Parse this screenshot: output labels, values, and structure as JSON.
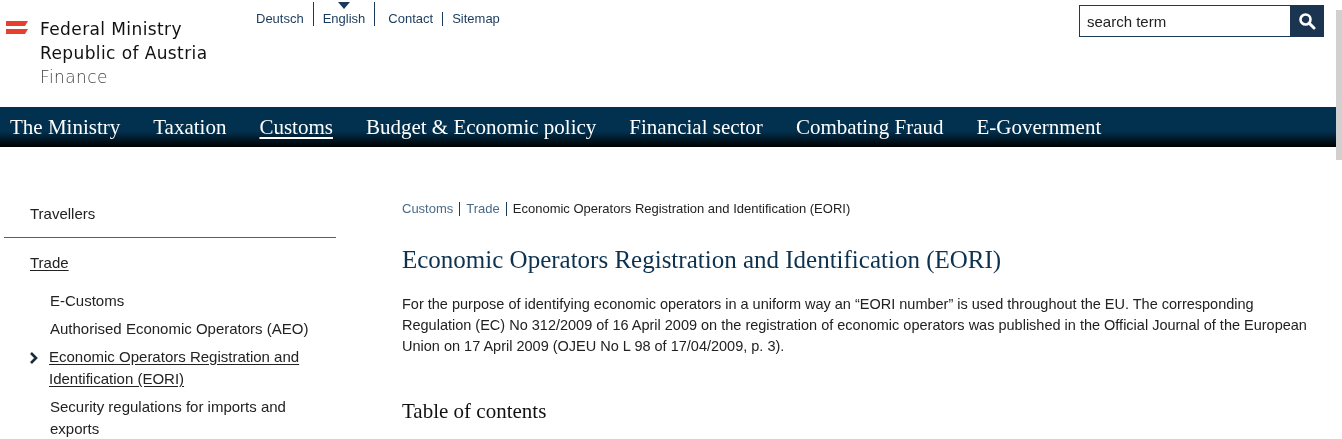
{
  "logo": {
    "lines": [
      "Federal Ministry",
      "Republic of Austria",
      "Finance"
    ]
  },
  "languages": [
    {
      "label": "Deutsch",
      "selected": false
    },
    {
      "label": "English",
      "selected": true
    }
  ],
  "service_links": [
    "Contact",
    "Sitemap"
  ],
  "search": {
    "placeholder": "search term"
  },
  "nav": [
    {
      "label": "The Ministry",
      "selected": false
    },
    {
      "label": "Taxation",
      "selected": false
    },
    {
      "label": "Customs",
      "selected": true
    },
    {
      "label": "Budget & Economic policy",
      "selected": false
    },
    {
      "label": "Financial sector",
      "selected": false
    },
    {
      "label": "Combating Fraud",
      "selected": false
    },
    {
      "label": "E-Government",
      "selected": false
    }
  ],
  "sidebar": {
    "items": [
      {
        "label": "Travellers",
        "expanded": false
      },
      {
        "label": "Trade",
        "expanded": true,
        "children": [
          {
            "label": "E-Customs",
            "selected": false
          },
          {
            "label": "Authorised Economic Operators (AEO)",
            "selected": false
          },
          {
            "label": "Economic Operators Registration and Identification (EORI)",
            "selected": true
          },
          {
            "label": "Security regulations for imports and exports",
            "selected": false
          }
        ]
      }
    ]
  },
  "breadcrumb": [
    "Customs",
    "Trade",
    "Economic Operators Registration and Identification (EORI)"
  ],
  "title": "Economic Operators Registration and Identification (EORI)",
  "intro": "For the purpose of identifying economic operators in a uniform way an “EORI number” is used throughout the EU. The corresponding Regulation (EC) No 312/2009 of 16 April 2009 on the registration of economic operators was published in the Official Journal of the European Union on 17 April 2009 (OJEU No L 98 of 17/04/2009, p. 3).",
  "toc_heading": "Table of contents"
}
